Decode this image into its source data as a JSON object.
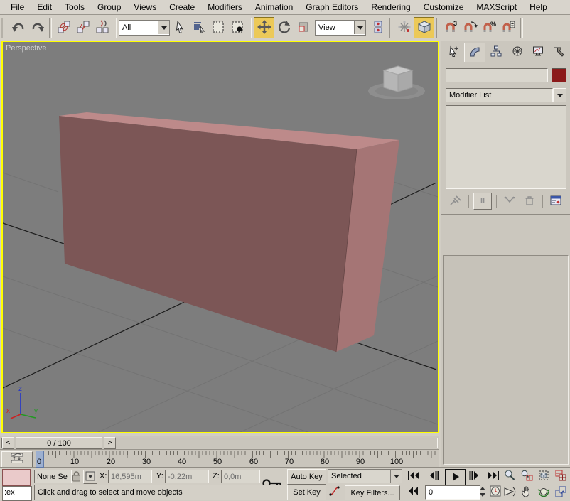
{
  "menu": {
    "items": [
      "File",
      "Edit",
      "Tools",
      "Group",
      "Views",
      "Create",
      "Modifiers",
      "Animation",
      "Graph Editors",
      "Rendering",
      "Customize",
      "MAXScript",
      "Help"
    ]
  },
  "toolbar": {
    "selection_filter": "All",
    "coord_system": "View"
  },
  "viewport": {
    "label": "Perspective",
    "axis": {
      "x": "x",
      "y": "y",
      "z": "z"
    },
    "colors": {
      "background": "#7d7d7d",
      "active_border": "#ffff00",
      "box_front": "#7c5656",
      "box_top": "#bd8a8a",
      "box_right": "#a57575"
    }
  },
  "command_panel": {
    "modifier_list": "Modifier List",
    "show_end_result": "II",
    "object_color": "#8b1a1a"
  },
  "timeline": {
    "prev": "<",
    "slider": "0 / 100",
    "next": ">",
    "current_frame": "0",
    "ticks": [
      "0",
      "10",
      "20",
      "30",
      "40",
      "50",
      "60",
      "70",
      "80",
      "90",
      "100"
    ]
  },
  "status": {
    "selection": "None Se",
    "x_label": "X:",
    "x_value": "16,595m",
    "y_label": "Y:",
    "y_value": "-0,22m",
    "z_label": "Z:",
    "z_value": "0,0m",
    "auto_key": "Auto Key",
    "set_key": "Set Key",
    "time_type": "Selected",
    "key_filters": "Key Filters...",
    "frame_field": "0",
    "prompt": "Click and drag to select and move objects",
    "listener": ":ex"
  }
}
